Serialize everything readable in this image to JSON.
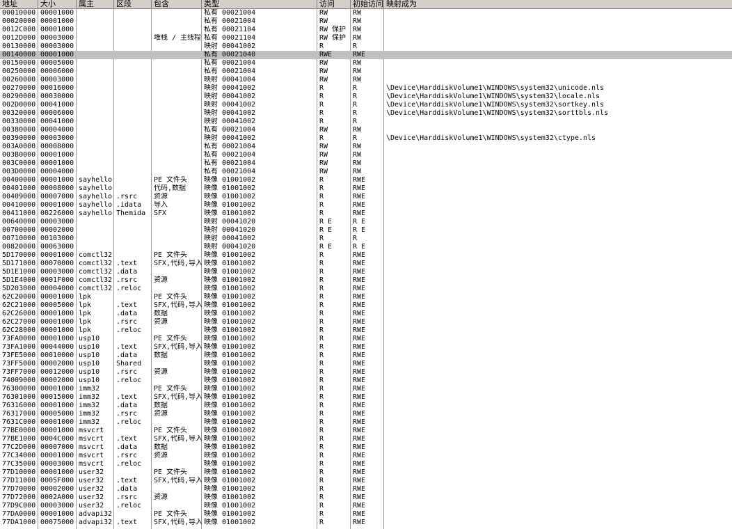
{
  "columns": [
    "地址",
    "大小",
    "属主",
    "区段",
    "包含",
    "类型",
    "访问",
    "初始访问",
    "映射成为"
  ],
  "rows": [
    {
      "addr": "00010000",
      "size": "00001000",
      "owner": "",
      "section": "",
      "contains": "",
      "type": "私有 00021004",
      "access": "RW",
      "init": "RW",
      "mapped": ""
    },
    {
      "addr": "00020000",
      "size": "00001000",
      "owner": "",
      "section": "",
      "contains": "",
      "type": "私有 00021004",
      "access": "RW",
      "init": "RW",
      "mapped": ""
    },
    {
      "addr": "0012C000",
      "size": "00001000",
      "owner": "",
      "section": "",
      "contains": "",
      "type": "私有 00021104",
      "access": "RW  保护",
      "init": "RW",
      "mapped": ""
    },
    {
      "addr": "0012D000",
      "size": "00003000",
      "owner": "",
      "section": "",
      "contains": "堆栈 / 主线程",
      "type": "私有 00021104",
      "access": "RW  保护",
      "init": "RW",
      "mapped": ""
    },
    {
      "addr": "00130000",
      "size": "00003000",
      "owner": "",
      "section": "",
      "contains": "",
      "type": "映射 00041002",
      "access": "R",
      "init": "R",
      "mapped": ""
    },
    {
      "addr": "00140000",
      "size": "00001000",
      "owner": "",
      "section": "",
      "contains": "",
      "type": "私有 00021040",
      "access": "RWE",
      "init": "RWE",
      "mapped": "",
      "selected": true
    },
    {
      "addr": "00150000",
      "size": "00005000",
      "owner": "",
      "section": "",
      "contains": "",
      "type": "私有 00021004",
      "access": "RW",
      "init": "RW",
      "mapped": ""
    },
    {
      "addr": "00250000",
      "size": "00006000",
      "owner": "",
      "section": "",
      "contains": "",
      "type": "私有 00021004",
      "access": "RW",
      "init": "RW",
      "mapped": ""
    },
    {
      "addr": "00260000",
      "size": "00003000",
      "owner": "",
      "section": "",
      "contains": "",
      "type": "映射 00041004",
      "access": "RW",
      "init": "RW",
      "mapped": ""
    },
    {
      "addr": "00270000",
      "size": "00016000",
      "owner": "",
      "section": "",
      "contains": "",
      "type": "映射 00041002",
      "access": "R",
      "init": "R",
      "mapped": "\\Device\\HarddiskVolume1\\WINDOWS\\system32\\unicode.nls"
    },
    {
      "addr": "00290000",
      "size": "00030000",
      "owner": "",
      "section": "",
      "contains": "",
      "type": "映射 00041002",
      "access": "R",
      "init": "R",
      "mapped": "\\Device\\HarddiskVolume1\\WINDOWS\\system32\\locale.nls"
    },
    {
      "addr": "002D0000",
      "size": "00041000",
      "owner": "",
      "section": "",
      "contains": "",
      "type": "映射 00041002",
      "access": "R",
      "init": "R",
      "mapped": "\\Device\\HarddiskVolume1\\WINDOWS\\system32\\sortkey.nls"
    },
    {
      "addr": "00320000",
      "size": "00006000",
      "owner": "",
      "section": "",
      "contains": "",
      "type": "映射 00041002",
      "access": "R",
      "init": "R",
      "mapped": "\\Device\\HarddiskVolume1\\WINDOWS\\system32\\sorttbls.nls"
    },
    {
      "addr": "00330000",
      "size": "00041000",
      "owner": "",
      "section": "",
      "contains": "",
      "type": "映射 00041002",
      "access": "R",
      "init": "R",
      "mapped": ""
    },
    {
      "addr": "00380000",
      "size": "00004000",
      "owner": "",
      "section": "",
      "contains": "",
      "type": "私有 00021004",
      "access": "RW",
      "init": "RW",
      "mapped": ""
    },
    {
      "addr": "00390000",
      "size": "00003000",
      "owner": "",
      "section": "",
      "contains": "",
      "type": "映射 00041002",
      "access": "R",
      "init": "R",
      "mapped": "\\Device\\HarddiskVolume1\\WINDOWS\\system32\\ctype.nls"
    },
    {
      "addr": "003A0000",
      "size": "00008000",
      "owner": "",
      "section": "",
      "contains": "",
      "type": "私有 00021004",
      "access": "RW",
      "init": "RW",
      "mapped": ""
    },
    {
      "addr": "003B0000",
      "size": "00001000",
      "owner": "",
      "section": "",
      "contains": "",
      "type": "私有 00021004",
      "access": "RW",
      "init": "RW",
      "mapped": ""
    },
    {
      "addr": "003C0000",
      "size": "00001000",
      "owner": "",
      "section": "",
      "contains": "",
      "type": "私有 00021004",
      "access": "RW",
      "init": "RW",
      "mapped": ""
    },
    {
      "addr": "003D0000",
      "size": "00004000",
      "owner": "",
      "section": "",
      "contains": "",
      "type": "私有 00021004",
      "access": "RW",
      "init": "RW",
      "mapped": ""
    },
    {
      "addr": "00400000",
      "size": "00001000",
      "owner": "sayhello",
      "section": "",
      "contains": "PE 文件头",
      "type": "映像 01001002",
      "access": "R",
      "init": "RWE",
      "mapped": ""
    },
    {
      "addr": "00401000",
      "size": "00008000",
      "owner": "sayhello",
      "section": "",
      "contains": "代码,数据",
      "type": "映像 01001002",
      "access": "R",
      "init": "RWE",
      "mapped": ""
    },
    {
      "addr": "00409000",
      "size": "00007000",
      "owner": "sayhello",
      "section": ".rsrc",
      "contains": "资源",
      "type": "映像 01001002",
      "access": "R",
      "init": "RWE",
      "mapped": ""
    },
    {
      "addr": "00410000",
      "size": "00001000",
      "owner": "sayhello",
      "section": ".idata",
      "contains": "导入",
      "type": "映像 01001002",
      "access": "R",
      "init": "RWE",
      "mapped": ""
    },
    {
      "addr": "00411000",
      "size": "00226000",
      "owner": "sayhello",
      "section": "Themida",
      "contains": "SFX",
      "type": "映像 01001002",
      "access": "R",
      "init": "RWE",
      "mapped": ""
    },
    {
      "addr": "00640000",
      "size": "00003000",
      "owner": "",
      "section": "",
      "contains": "",
      "type": "映射 00041020",
      "access": "R E",
      "init": "R E",
      "mapped": ""
    },
    {
      "addr": "00700000",
      "size": "00002000",
      "owner": "",
      "section": "",
      "contains": "",
      "type": "映射 00041020",
      "access": "R E",
      "init": "R E",
      "mapped": ""
    },
    {
      "addr": "00710000",
      "size": "00103000",
      "owner": "",
      "section": "",
      "contains": "",
      "type": "映射 00041002",
      "access": "R",
      "init": "R",
      "mapped": ""
    },
    {
      "addr": "00820000",
      "size": "00063000",
      "owner": "",
      "section": "",
      "contains": "",
      "type": "映射 00041020",
      "access": "R E",
      "init": "R E",
      "mapped": ""
    },
    {
      "addr": "5D170000",
      "size": "00001000",
      "owner": "comctl32",
      "section": "",
      "contains": "PE 文件头",
      "type": "映像 01001002",
      "access": "R",
      "init": "RWE",
      "mapped": ""
    },
    {
      "addr": "5D171000",
      "size": "00070000",
      "owner": "comctl32",
      "section": ".text",
      "contains": "SFX,代码,导入",
      "type": "映像 01001002",
      "access": "R",
      "init": "RWE",
      "mapped": ""
    },
    {
      "addr": "5D1E1000",
      "size": "00003000",
      "owner": "comctl32",
      "section": ".data",
      "contains": "",
      "type": "映像 01001002",
      "access": "R",
      "init": "RWE",
      "mapped": ""
    },
    {
      "addr": "5D1E4000",
      "size": "0001F000",
      "owner": "comctl32",
      "section": ".rsrc",
      "contains": "资源",
      "type": "映像 01001002",
      "access": "R",
      "init": "RWE",
      "mapped": ""
    },
    {
      "addr": "5D203000",
      "size": "00004000",
      "owner": "comctl32",
      "section": ".reloc",
      "contains": "",
      "type": "映像 01001002",
      "access": "R",
      "init": "RWE",
      "mapped": ""
    },
    {
      "addr": "62C20000",
      "size": "00001000",
      "owner": "lpk",
      "section": "",
      "contains": "PE 文件头",
      "type": "映像 01001002",
      "access": "R",
      "init": "RWE",
      "mapped": ""
    },
    {
      "addr": "62C21000",
      "size": "00005000",
      "owner": "lpk",
      "section": ".text",
      "contains": "SFX,代码,导入",
      "type": "映像 01001002",
      "access": "R",
      "init": "RWE",
      "mapped": ""
    },
    {
      "addr": "62C26000",
      "size": "00001000",
      "owner": "lpk",
      "section": ".data",
      "contains": "数据",
      "type": "映像 01001002",
      "access": "R",
      "init": "RWE",
      "mapped": ""
    },
    {
      "addr": "62C27000",
      "size": "00001000",
      "owner": "lpk",
      "section": ".rsrc",
      "contains": "资源",
      "type": "映像 01001002",
      "access": "R",
      "init": "RWE",
      "mapped": ""
    },
    {
      "addr": "62C28000",
      "size": "00001000",
      "owner": "lpk",
      "section": ".reloc",
      "contains": "",
      "type": "映像 01001002",
      "access": "R",
      "init": "RWE",
      "mapped": ""
    },
    {
      "addr": "73FA0000",
      "size": "00001000",
      "owner": "usp10",
      "section": "",
      "contains": "PE 文件头",
      "type": "映像 01001002",
      "access": "R",
      "init": "RWE",
      "mapped": ""
    },
    {
      "addr": "73FA1000",
      "size": "00044000",
      "owner": "usp10",
      "section": ".text",
      "contains": "SFX,代码,导入",
      "type": "映像 01001002",
      "access": "R",
      "init": "RWE",
      "mapped": ""
    },
    {
      "addr": "73FE5000",
      "size": "00010000",
      "owner": "usp10",
      "section": ".data",
      "contains": "数据",
      "type": "映像 01001002",
      "access": "R",
      "init": "RWE",
      "mapped": ""
    },
    {
      "addr": "73FF5000",
      "size": "00002000",
      "owner": "usp10",
      "section": "Shared",
      "contains": "",
      "type": "映像 01001002",
      "access": "R",
      "init": "RWE",
      "mapped": ""
    },
    {
      "addr": "73FF7000",
      "size": "00012000",
      "owner": "usp10",
      "section": ".rsrc",
      "contains": "资源",
      "type": "映像 01001002",
      "access": "R",
      "init": "RWE",
      "mapped": ""
    },
    {
      "addr": "74009000",
      "size": "00002000",
      "owner": "usp10",
      "section": ".reloc",
      "contains": "",
      "type": "映像 01001002",
      "access": "R",
      "init": "RWE",
      "mapped": ""
    },
    {
      "addr": "76300000",
      "size": "00001000",
      "owner": "imm32",
      "section": "",
      "contains": "PE 文件头",
      "type": "映像 01001002",
      "access": "R",
      "init": "RWE",
      "mapped": ""
    },
    {
      "addr": "76301000",
      "size": "00015000",
      "owner": "imm32",
      "section": ".text",
      "contains": "SFX,代码,导入",
      "type": "映像 01001002",
      "access": "R",
      "init": "RWE",
      "mapped": ""
    },
    {
      "addr": "76316000",
      "size": "00001000",
      "owner": "imm32",
      "section": ".data",
      "contains": "数据",
      "type": "映像 01001002",
      "access": "R",
      "init": "RWE",
      "mapped": ""
    },
    {
      "addr": "76317000",
      "size": "00005000",
      "owner": "imm32",
      "section": ".rsrc",
      "contains": "资源",
      "type": "映像 01001002",
      "access": "R",
      "init": "RWE",
      "mapped": ""
    },
    {
      "addr": "7631C000",
      "size": "00001000",
      "owner": "imm32",
      "section": ".reloc",
      "contains": "",
      "type": "映像 01001002",
      "access": "R",
      "init": "RWE",
      "mapped": ""
    },
    {
      "addr": "77BE0000",
      "size": "00001000",
      "owner": "msvcrt",
      "section": "",
      "contains": "PE 文件头",
      "type": "映像 01001002",
      "access": "R",
      "init": "RWE",
      "mapped": ""
    },
    {
      "addr": "77BE1000",
      "size": "0004C000",
      "owner": "msvcrt",
      "section": ".text",
      "contains": "SFX,代码,导入",
      "type": "映像 01001002",
      "access": "R",
      "init": "RWE",
      "mapped": ""
    },
    {
      "addr": "77C2D000",
      "size": "00007000",
      "owner": "msvcrt",
      "section": ".data",
      "contains": "数据",
      "type": "映像 01001002",
      "access": "R",
      "init": "RWE",
      "mapped": ""
    },
    {
      "addr": "77C34000",
      "size": "00001000",
      "owner": "msvcrt",
      "section": ".rsrc",
      "contains": "资源",
      "type": "映像 01001002",
      "access": "R",
      "init": "RWE",
      "mapped": ""
    },
    {
      "addr": "77C35000",
      "size": "00003000",
      "owner": "msvcrt",
      "section": ".reloc",
      "contains": "",
      "type": "映像 01001002",
      "access": "R",
      "init": "RWE",
      "mapped": ""
    },
    {
      "addr": "77D10000",
      "size": "00001000",
      "owner": "user32",
      "section": "",
      "contains": "PE 文件头",
      "type": "映像 01001002",
      "access": "R",
      "init": "RWE",
      "mapped": ""
    },
    {
      "addr": "77D11000",
      "size": "0005F000",
      "owner": "user32",
      "section": ".text",
      "contains": "SFX,代码,导入",
      "type": "映像 01001002",
      "access": "R",
      "init": "RWE",
      "mapped": ""
    },
    {
      "addr": "77D70000",
      "size": "00002000",
      "owner": "user32",
      "section": ".data",
      "contains": "",
      "type": "映像 01001002",
      "access": "R",
      "init": "RWE",
      "mapped": ""
    },
    {
      "addr": "77D72000",
      "size": "0002A000",
      "owner": "user32",
      "section": ".rsrc",
      "contains": "资源",
      "type": "映像 01001002",
      "access": "R",
      "init": "RWE",
      "mapped": ""
    },
    {
      "addr": "77D9C000",
      "size": "00003000",
      "owner": "user32",
      "section": ".reloc",
      "contains": "",
      "type": "映像 01001002",
      "access": "R",
      "init": "RWE",
      "mapped": ""
    },
    {
      "addr": "77DA0000",
      "size": "00001000",
      "owner": "advapi32",
      "section": "",
      "contains": "PE 文件头",
      "type": "映像 01001002",
      "access": "R",
      "init": "RWE",
      "mapped": ""
    },
    {
      "addr": "77DA1000",
      "size": "00075000",
      "owner": "advapi32",
      "section": ".text",
      "contains": "SFX,代码,导入",
      "type": "映像 01001002",
      "access": "R",
      "init": "RWE",
      "mapped": ""
    }
  ]
}
